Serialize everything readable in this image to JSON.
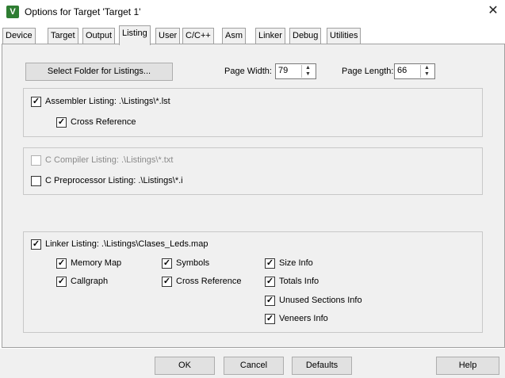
{
  "window": {
    "icon_letter": "V",
    "title": "Options for Target 'Target 1'",
    "close_glyph": "✕"
  },
  "tabs": [
    "Device",
    "Target",
    "Output",
    "Listing",
    "User",
    "C/C++",
    "Asm",
    "Linker",
    "Debug",
    "Utilities"
  ],
  "active_tab": "Listing",
  "listing": {
    "select_folder_label": "Select Folder for Listings...",
    "page_width_label": "Page Width:",
    "page_width_value": "79",
    "page_length_label": "Page Length:",
    "page_length_value": "66",
    "assembler_listing": {
      "label": "Assembler Listing:  .\\Listings\\*.lst",
      "checked": true
    },
    "cross_reference": {
      "label": "Cross Reference",
      "checked": true
    },
    "c_compiler_listing": {
      "label": "C Compiler Listing:  .\\Listings\\*.txt",
      "checked": false,
      "disabled": true
    },
    "c_preprocessor_listing": {
      "label": "C Preprocessor Listing:  .\\Listings\\*.i",
      "checked": false
    },
    "linker_listing": {
      "label": "Linker Listing:  .\\Listings\\Clases_Leds.map",
      "checked": true
    },
    "linker_options": {
      "memory_map": "Memory Map",
      "callgraph": "Callgraph",
      "symbols": "Symbols",
      "cross_reference": "Cross Reference",
      "size_info": "Size Info",
      "totals_info": "Totals Info",
      "unused_sections_info": "Unused Sections Info",
      "veneers_info": "Veneers Info"
    }
  },
  "footer": {
    "ok": "OK",
    "cancel": "Cancel",
    "defaults": "Defaults",
    "help": "Help"
  },
  "colors": {
    "panel_bg": "#f0f0f0",
    "icon_green": "#2e7d32"
  }
}
